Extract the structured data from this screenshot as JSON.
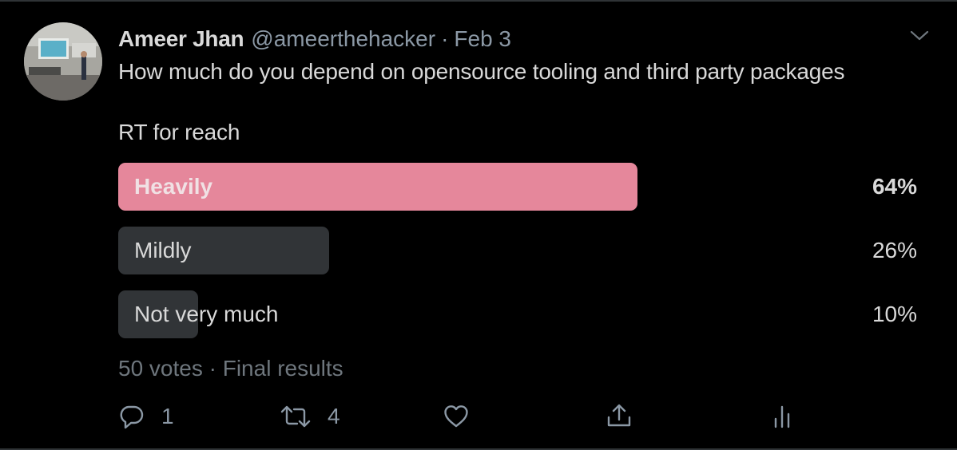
{
  "tweet": {
    "author_name": "Ameer Jhan",
    "handle": "@ameerthehacker",
    "separator": "·",
    "date": "Feb 3",
    "text_line1": "How much do you depend on opensource tooling and third party packages",
    "text_line2": "RT for reach"
  },
  "poll": {
    "options": [
      {
        "label": "Heavily",
        "percent_text": "64%",
        "percent": 64,
        "winner": true
      },
      {
        "label": "Mildly",
        "percent_text": "26%",
        "percent": 26,
        "winner": false
      },
      {
        "label": "Not very much",
        "percent_text": "10%",
        "percent": 10,
        "winner": false
      }
    ],
    "meta": "50 votes · Final results"
  },
  "actions": {
    "reply_count": "1",
    "retweet_count": "4"
  },
  "icons": [
    "chevron-down-icon",
    "reply-icon",
    "retweet-icon",
    "like-icon",
    "share-icon",
    "analytics-icon"
  ],
  "colors": {
    "background": "#000000",
    "winner_bar": "#e5879b",
    "bar": "#313437",
    "secondary_text": "#8b98a5"
  }
}
